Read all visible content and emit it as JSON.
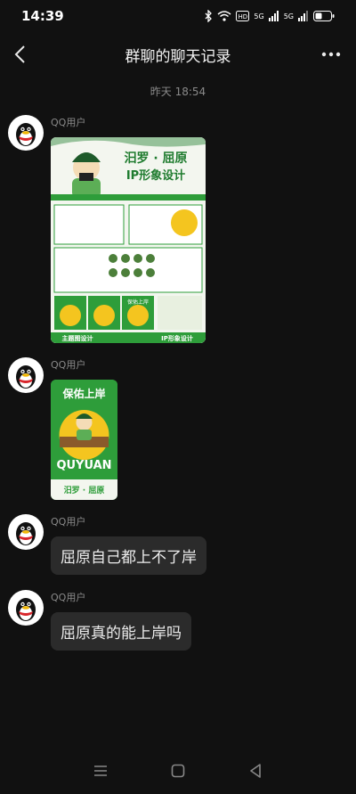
{
  "status_bar": {
    "time": "14:39",
    "network_1": "5G",
    "network_2": "5G"
  },
  "header": {
    "title": "群聊的聊天记录"
  },
  "chat": {
    "timestamp": "昨天 18:54",
    "messages": [
      {
        "sender": "QQ用户",
        "type": "image",
        "poster": {
          "title_line1": "汨罗 · 屈原",
          "title_line2": "IP形象设计",
          "badge1": "保佑上岸",
          "bottom_left": "主题图设计",
          "bottom_right": "IP形象设计"
        }
      },
      {
        "sender": "QQ用户",
        "type": "image",
        "sticker": {
          "top_text": "保佑上岸",
          "brand": "QUYUAN",
          "bottom_text": "汨罗 · 屈原"
        }
      },
      {
        "sender": "QQ用户",
        "type": "text",
        "text": "屈原自己都上不了岸"
      },
      {
        "sender": "QQ用户",
        "type": "text",
        "text": "屈原真的能上岸吗"
      }
    ]
  },
  "colors": {
    "background": "#111111",
    "bubble": "#2b2b2b",
    "poster_green": "#2e9d3a",
    "poster_yellow": "#f4c51f"
  }
}
